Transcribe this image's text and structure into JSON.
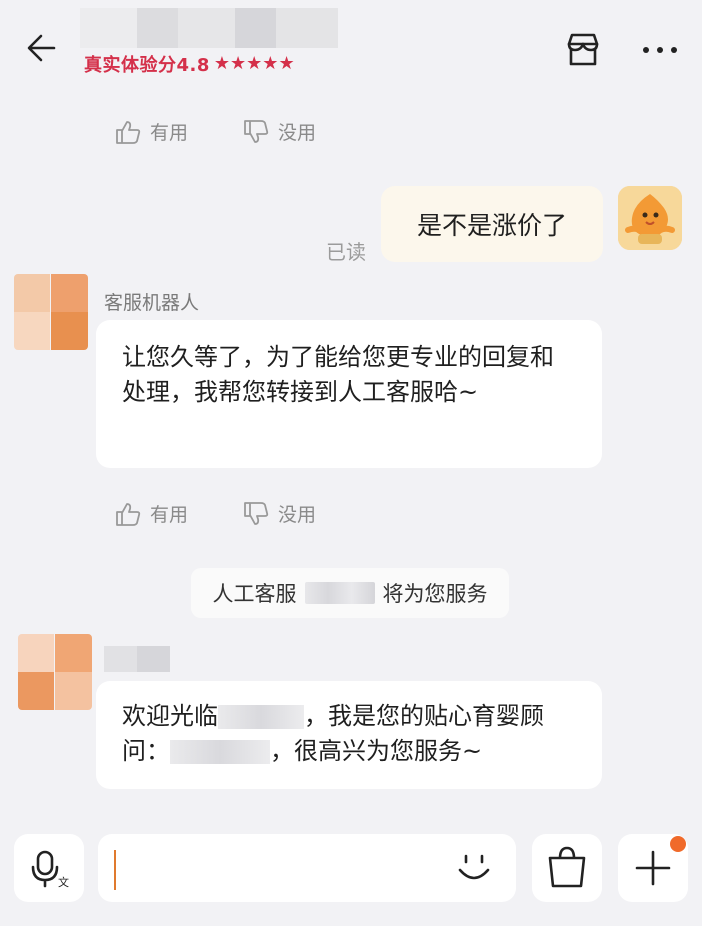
{
  "header": {
    "rating_label": "真实体验分4.8",
    "stars": "★★★★★",
    "icons": [
      "back-arrow-icon",
      "store-icon",
      "more-icon"
    ]
  },
  "feedback": {
    "useful": "有用",
    "useless": "没用"
  },
  "messages": {
    "user_message": "是不是涨价了",
    "read_status": "已读",
    "bot_name": "客服机器人",
    "bot_message": "让您久等了，为了能给您更专业的回复和处理，我帮您转接到人工客服哈~",
    "system_prefix": "人工客服",
    "system_suffix": "将为您服务",
    "agent_part1": "欢迎光临",
    "agent_part2": "，我是您的贴心育婴顾问：",
    "agent_part3": "，很高兴为您服务~"
  },
  "bottom_bar": {
    "icons": [
      "voice-to-text-icon",
      "smile-icon",
      "shopping-bag-icon",
      "plus-icon"
    ]
  },
  "colors": {
    "accent_red": "#d4304a",
    "cursor_orange": "#e07a2e",
    "badge_orange": "#f06a2a",
    "background": "#f2f2f5"
  }
}
